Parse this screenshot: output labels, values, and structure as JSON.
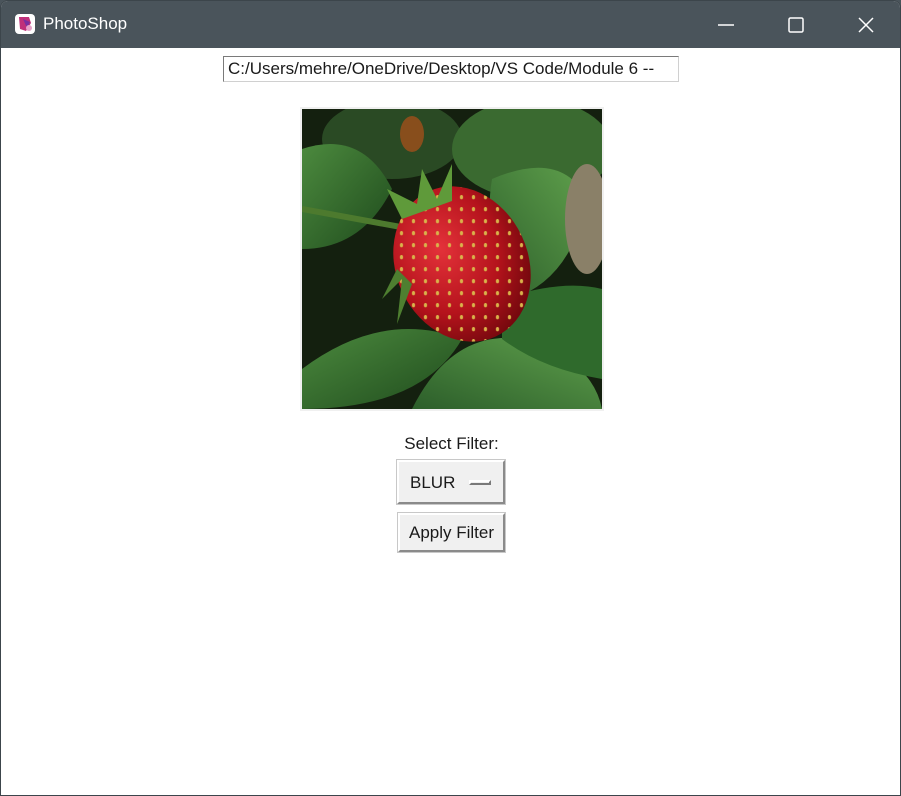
{
  "window": {
    "title": "PhotoShop",
    "icon": "photoshop-app-icon",
    "titlebar_color": "#4a545b"
  },
  "path_field": {
    "value": "C:/Users/mehre/OneDrive/Desktop/VS Code/Module 6 --"
  },
  "image": {
    "subject": "strawberry-photo"
  },
  "filter": {
    "label": "Select Filter:",
    "selected": "BLUR"
  },
  "apply_button": {
    "label": "Apply Filter"
  }
}
